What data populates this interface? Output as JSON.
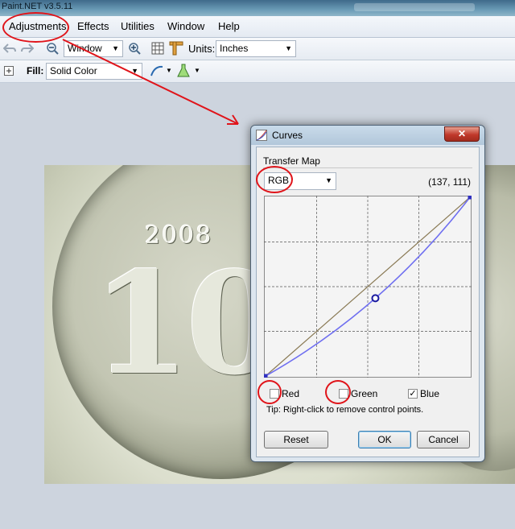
{
  "window": {
    "title": "Paint.NET v3.5.11"
  },
  "menu": {
    "items": [
      "Adjustments",
      "Effects",
      "Utilities",
      "Window",
      "Help"
    ]
  },
  "toolbar1": {
    "zoom_value": "Window",
    "units_label": "Units:",
    "units_value": "Inches"
  },
  "toolbar2": {
    "fill_label": "Fill:",
    "fill_value": "Solid Color"
  },
  "coin": {
    "year": "2008",
    "denomination": "10"
  },
  "curves": {
    "title": "Curves",
    "group_label": "Transfer Map",
    "mode": "RGB",
    "coords": "(137, 111)",
    "checkboxes": [
      {
        "label": "Red",
        "checked": false
      },
      {
        "label": "Green",
        "checked": false
      },
      {
        "label": "Blue",
        "checked": true
      }
    ],
    "tip": "Tip: Right-click to remove control points.",
    "buttons": {
      "reset": "Reset",
      "ok": "OK",
      "cancel": "Cancel"
    },
    "control_point": [
      137,
      111
    ],
    "colors": {
      "curve": "#6f6ff0",
      "diagonal": "#8a7a55"
    }
  },
  "annotation_color": "#e0141a"
}
